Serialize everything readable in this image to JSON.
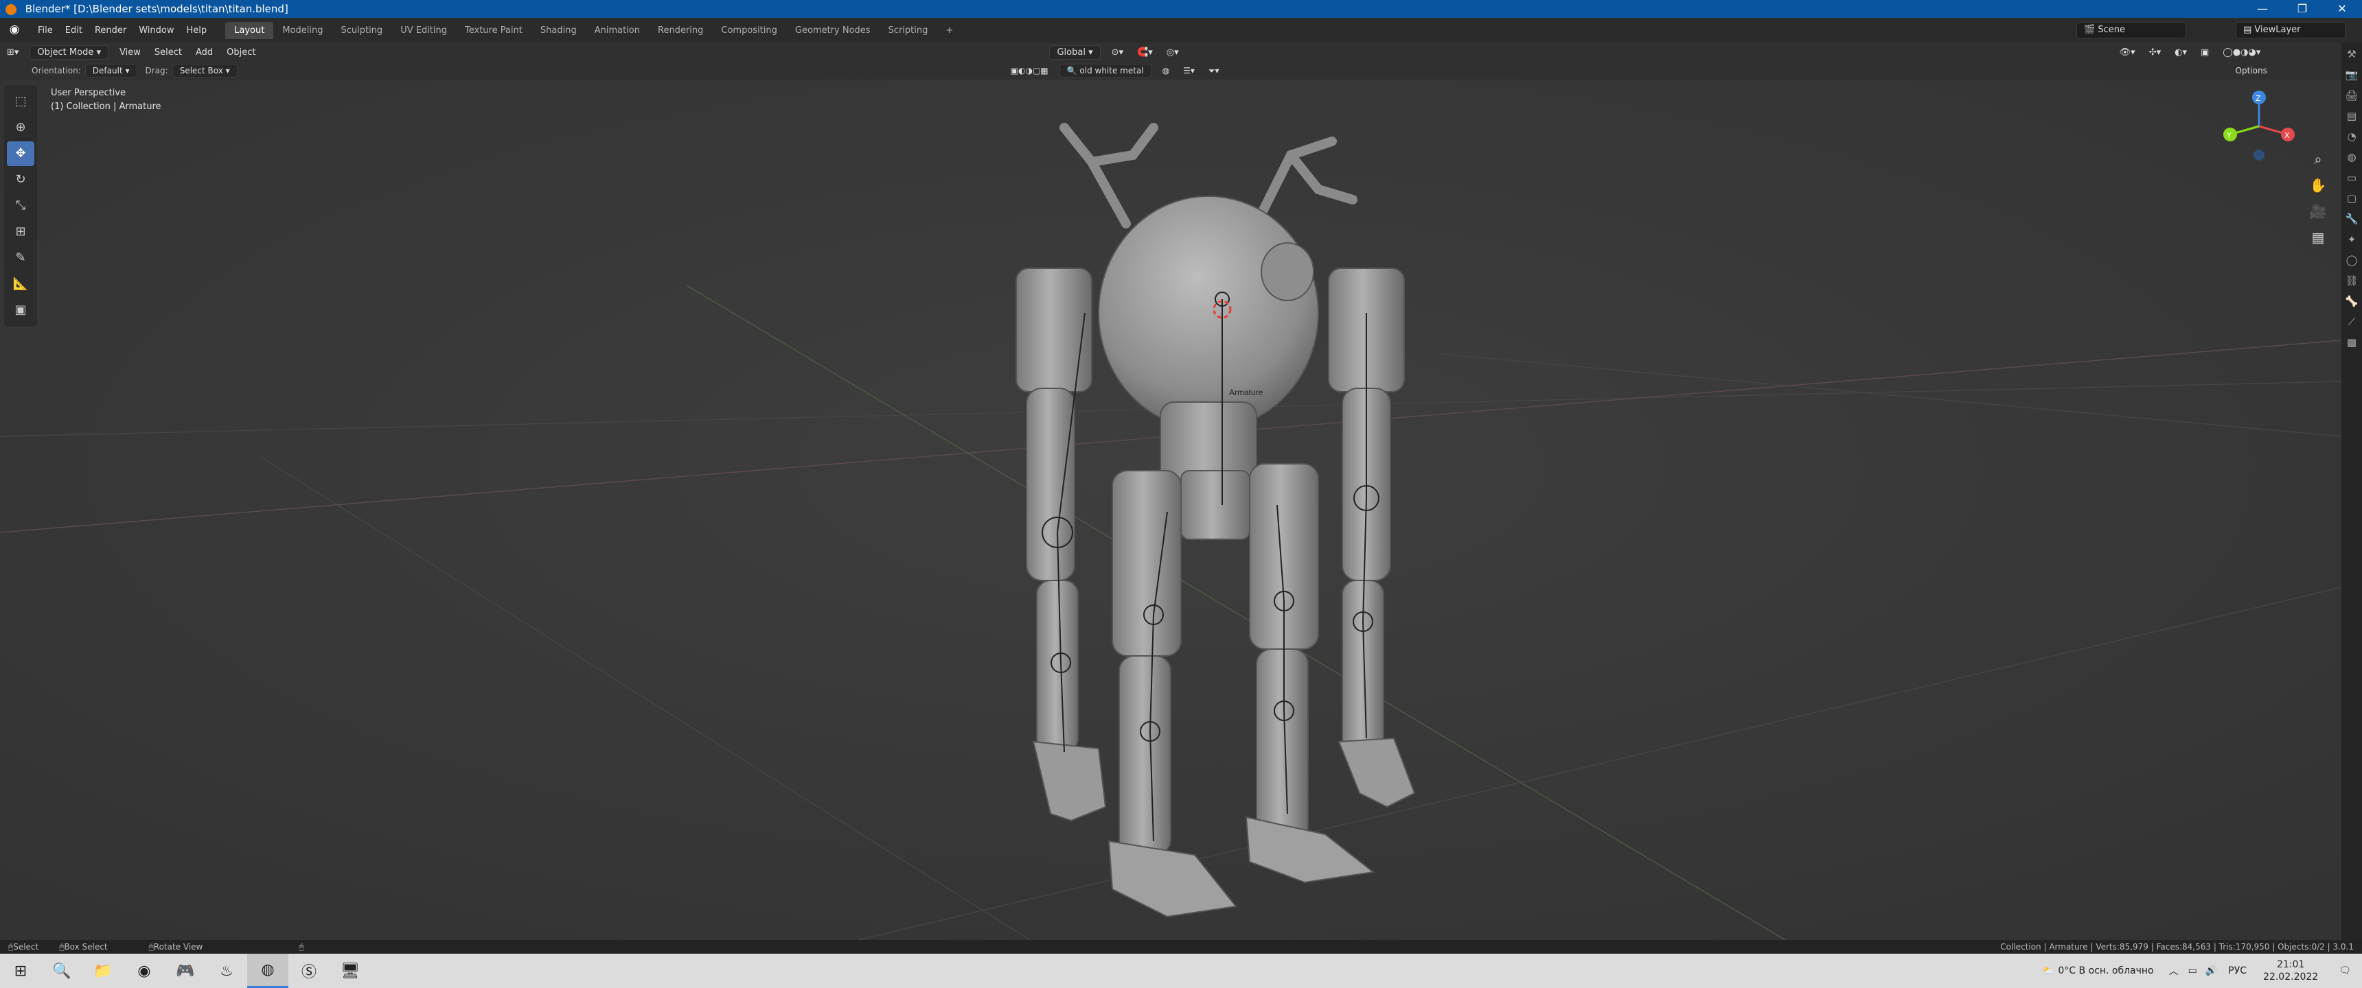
{
  "window": {
    "title": "Blender* [D:\\Blender sets\\models\\titan\\titan.blend]",
    "minimize": "—",
    "maximize": "❐",
    "close": "✕"
  },
  "menus": [
    "File",
    "Edit",
    "Render",
    "Window",
    "Help"
  ],
  "workspaces": [
    "Layout",
    "Modeling",
    "Sculpting",
    "UV Editing",
    "Texture Paint",
    "Shading",
    "Animation",
    "Rendering",
    "Compositing",
    "Geometry Nodes",
    "Scripting",
    "+"
  ],
  "scene": "Scene",
  "view_layer": "ViewLayer",
  "header": {
    "mode": "Object Mode",
    "items": [
      "View",
      "Select",
      "Add",
      "Object"
    ],
    "transform_orientation": "Global",
    "options": "Options"
  },
  "header2": {
    "orientation_label": "Orientation:",
    "orientation_value": "Default",
    "drag_label": "Drag:",
    "drag_value": "Select Box",
    "material_search": "old white metal"
  },
  "viewport": {
    "perspective": "User Perspective",
    "collection": "(1) Collection | Armature",
    "armature_label": "Armature"
  },
  "gizmo": {
    "x": "X",
    "y": "Y",
    "z": "Z"
  },
  "statusbar": {
    "select": "Select",
    "box_select": "Box Select",
    "rotate_view": "Rotate View",
    "stats": "Collection | Armature | Verts:85,979 | Faces:84,563 | Tris:170,950 | Objects:0/2 | 3.0.1"
  },
  "taskbar": {
    "weather": "0°C  В осн. облачно",
    "lang": "РУС",
    "time": "21:01",
    "date": "22.02.2022"
  },
  "colors": {
    "titlebar": "#0a55a0",
    "active_tool": "#4772b3",
    "viewport_bg": "#393939",
    "x_axis": "#e5484d",
    "y_axis": "#8bdc1a",
    "z_axis": "#3d87e0"
  }
}
